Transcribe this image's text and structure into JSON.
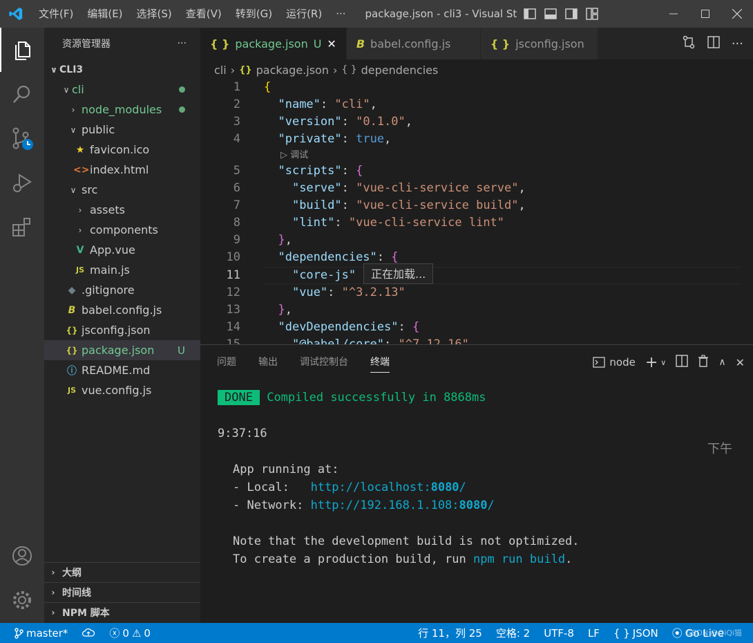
{
  "titlebar": {
    "menus": [
      "文件(F)",
      "编辑(E)",
      "选择(S)",
      "查看(V)",
      "转到(G)",
      "运行(R)",
      "···"
    ],
    "title": "package.json - cli3 - Visual St..."
  },
  "sidebar": {
    "header": "资源管理器",
    "more": "···",
    "root": "CLI3",
    "items": [
      {
        "label": "cli",
        "type": "folder-open"
      },
      {
        "label": "node_modules",
        "type": "folder"
      },
      {
        "label": "public",
        "type": "folder-open"
      },
      {
        "label": "favicon.ico",
        "type": "star"
      },
      {
        "label": "index.html",
        "type": "html"
      },
      {
        "label": "src",
        "type": "folder-open"
      },
      {
        "label": "assets",
        "type": "folder"
      },
      {
        "label": "components",
        "type": "folder"
      },
      {
        "label": "App.vue",
        "type": "vue"
      },
      {
        "label": "main.js",
        "type": "js"
      },
      {
        "label": ".gitignore",
        "type": "git"
      },
      {
        "label": "babel.config.js",
        "type": "babel"
      },
      {
        "label": "jsconfig.json",
        "type": "json"
      },
      {
        "label": "package.json",
        "type": "json",
        "badge": "U"
      },
      {
        "label": "README.md",
        "type": "info"
      },
      {
        "label": "vue.config.js",
        "type": "js"
      }
    ],
    "sections": [
      "大纲",
      "时间线",
      "NPM 脚本"
    ]
  },
  "tabs": [
    {
      "label": "package.json",
      "icon": "{ }",
      "status": "U"
    },
    {
      "label": "babel.config.js",
      "icon": "B"
    },
    {
      "label": "jsconfig.json",
      "icon": "{ }"
    }
  ],
  "breadcrumb": {
    "a": "cli",
    "b": "package.json",
    "c": "dependencies"
  },
  "editor": {
    "line_numbers": [
      "1",
      "2",
      "3",
      "4",
      "5",
      "6",
      "7",
      "8",
      "9",
      "10",
      "11",
      "12",
      "13",
      "14",
      "15"
    ],
    "codelens": "调试",
    "hover": "正在加载...",
    "name_key": "\"name\"",
    "name_val": "\"cli\"",
    "version_key": "\"version\"",
    "version_val": "\"0.1.0\"",
    "private_key": "\"private\"",
    "private_val": "true",
    "scripts_key": "\"scripts\"",
    "serve_key": "\"serve\"",
    "serve_val": "\"vue-cli-service serve\"",
    "build_key": "\"build\"",
    "build_val": "\"vue-cli-service build\"",
    "lint_key": "\"lint\"",
    "lint_val": "\"vue-cli-service lint\"",
    "deps_key": "\"dependencies\"",
    "core_key": "\"core-js\"",
    "vue_key": "\"vue\"",
    "vue_val": "\"^3.2.13\"",
    "devdeps_key": "\"devDependencies\"",
    "babel_key": "\"@babel/core\"",
    "babel_val": "\"^7.12.16\""
  },
  "panel": {
    "tabs": [
      "问题",
      "输出",
      "调试控制台",
      "终端"
    ],
    "shell": "node",
    "done": "DONE",
    "compiled": "Compiled successfully in 8868ms",
    "afternoon": "下午",
    "time": "9:37:16",
    "app_running": "App running at:",
    "local_label": "- Local:   ",
    "local_url": "http://localhost:",
    "local_port": "8080",
    "network_label": "- Network: ",
    "network_url": "http://192.168.1.108:",
    "network_port": "8080",
    "note1": "Note that the development build is not optimized.",
    "note2_a": "To create a production build, run ",
    "note2_b": "npm run build",
    "note2_c": "."
  },
  "statusbar": {
    "branch": "master*",
    "errors": "0",
    "warnings": "0",
    "position": "行 11，列 25",
    "spaces": "空格: 2",
    "encoding": "UTF-8",
    "eol": "LF",
    "language": "JSON",
    "golive": "Go Live",
    "watermark": "CSDN @QiQi猫"
  },
  "colors": {
    "accent": "#007acc",
    "modified": "#73c991",
    "titlebar": "#3c3c3c"
  }
}
